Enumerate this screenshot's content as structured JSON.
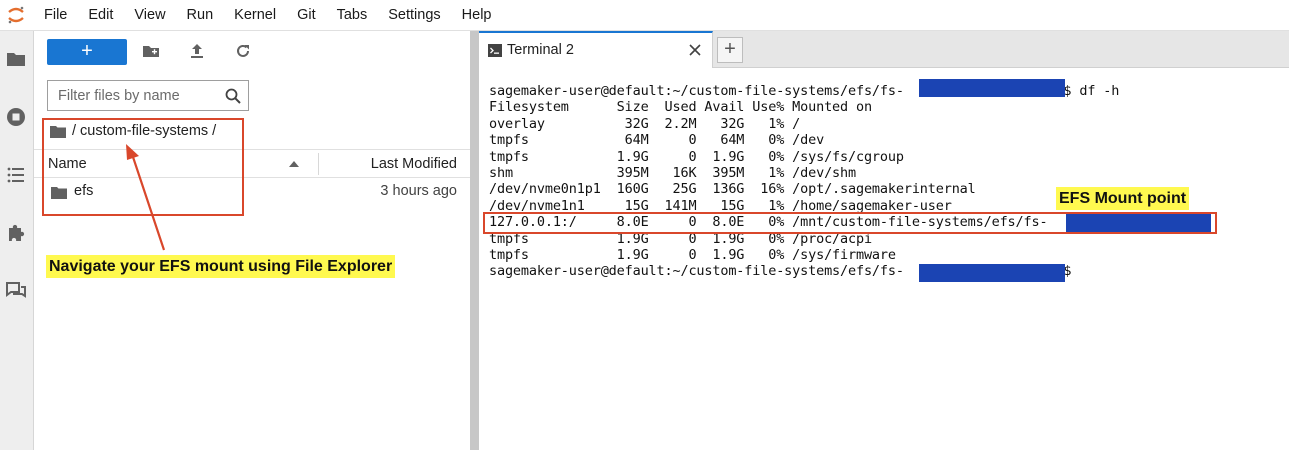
{
  "menu": [
    "File",
    "Edit",
    "View",
    "Run",
    "Kernel",
    "Git",
    "Tabs",
    "Settings",
    "Help"
  ],
  "icons": {
    "logo": "jupyter-logo-icon",
    "activity": [
      "folder-icon",
      "running-icon",
      "list-icon",
      "extension-icon",
      "chat-icon"
    ],
    "toolbar": [
      "new-folder-icon",
      "upload-icon",
      "refresh-icon"
    ],
    "search": "search-icon",
    "terminal": "terminal-icon",
    "close": "close-icon"
  },
  "colors": {
    "accent": "#1976d2",
    "annotation_red": "#d9472b",
    "highlight": "#fff94f",
    "redaction": "#1b44b3"
  },
  "file_browser": {
    "new_button_label": "+",
    "filter_placeholder": "Filter files by name",
    "breadcrumb": "/ custom-file-systems /",
    "columns": {
      "name": "Name",
      "modified": "Last Modified"
    },
    "files": [
      {
        "name": "efs",
        "modified": "3 hours ago"
      }
    ]
  },
  "annotations": {
    "left": "Navigate your EFS mount using File Explorer",
    "right": "EFS Mount point"
  },
  "terminal": {
    "tab_label": "Terminal 2",
    "add_tab_label": "+",
    "lines": [
      "sagemaker-user@default:~/custom-file-systems/efs/fs-                    $ df -h",
      "Filesystem      Size  Used Avail Use% Mounted on",
      "overlay          32G  2.2M   32G   1% /",
      "tmpfs            64M     0   64M   0% /dev",
      "tmpfs           1.9G     0  1.9G   0% /sys/fs/cgroup",
      "shm             395M   16K  395M   1% /dev/shm",
      "/dev/nvme0n1p1  160G   25G  136G  16% /opt/.sagemakerinternal",
      "/dev/nvme1n1     15G  141M   15G   1% /home/sagemaker-user",
      "127.0.0.1:/     8.0E     0  8.0E   0% /mnt/custom-file-systems/efs/fs-",
      "tmpfs           1.9G     0  1.9G   0% /proc/acpi",
      "tmpfs           1.9G     0  1.9G   0% /sys/firmware",
      "sagemaker-user@default:~/custom-file-systems/efs/fs-                    $"
    ]
  }
}
